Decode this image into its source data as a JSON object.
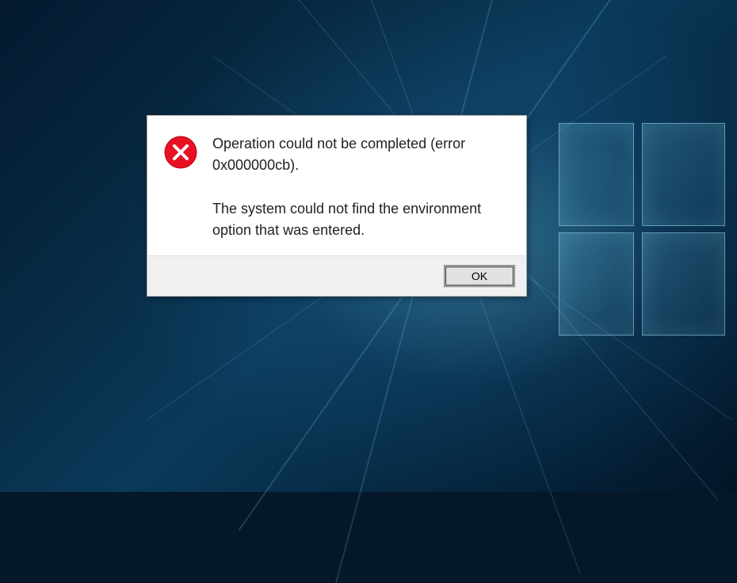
{
  "dialog": {
    "error_message_line1": "Operation could not be completed (error 0x000000cb).",
    "error_message_line2": "The system could not find the environment option that was entered.",
    "ok_button_label": "OK",
    "icon": "error-x-icon"
  }
}
